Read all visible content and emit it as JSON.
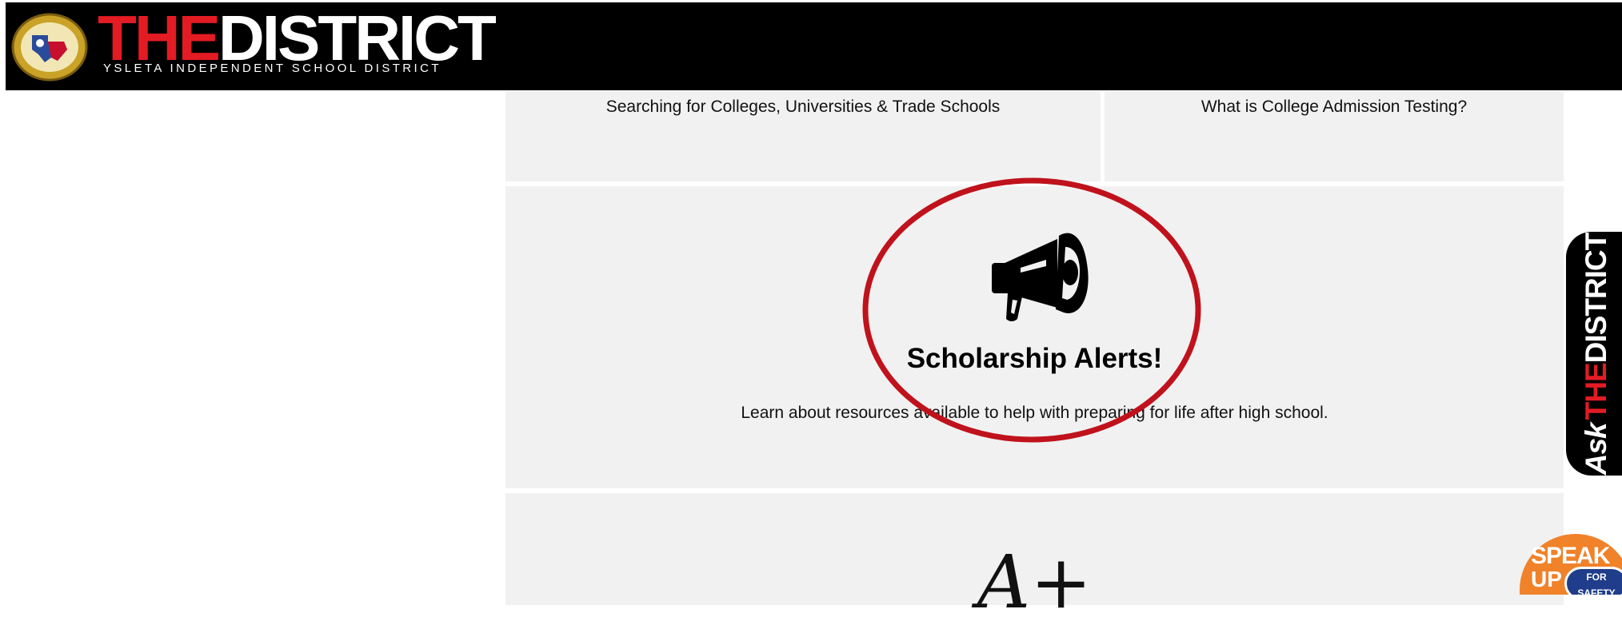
{
  "header": {
    "logo_the": "THE",
    "logo_district": "DISTRICT",
    "logo_subtitle": "YSLETA INDEPENDENT SCHOOL DISTRICT",
    "seal_icon": "district-seal-icon"
  },
  "tiles": {
    "colleges_label": "Searching for Colleges, Universities & Trade Schools",
    "testing_label": "What is College Admission Testing?",
    "scholarship": {
      "icon": "megaphone-icon",
      "title": "Scholarship Alerts!",
      "description": "Learn about resources available to help with preparing for life after high school."
    },
    "grades": {
      "glyph": "A+"
    }
  },
  "ask_tab": {
    "ask": "Ask",
    "the": "THE",
    "district": "DISTRICT"
  },
  "speak_up": {
    "speak": "SPEAK",
    "up": "UP",
    "for_safety": "FOR SAFETY"
  },
  "colors": {
    "brand_red": "#e31b23",
    "header_bg": "#000000",
    "panel_bg": "#f1f1f1",
    "highlight_ring": "#c0121c",
    "speakup_orange": "#f0822a",
    "speakup_blue": "#1f3d8a"
  }
}
